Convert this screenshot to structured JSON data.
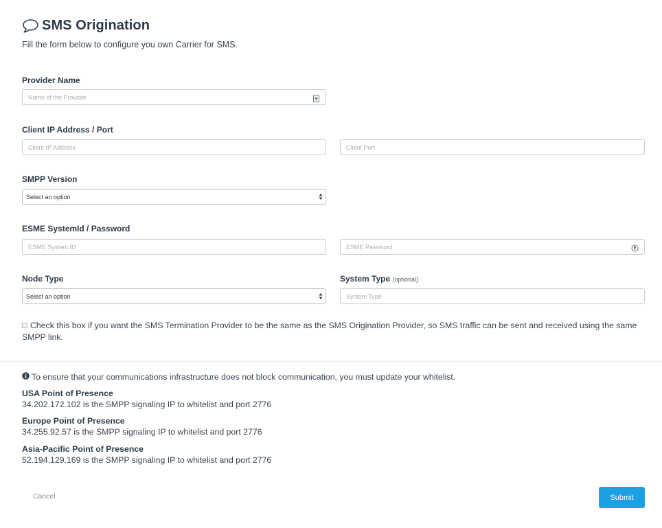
{
  "header": {
    "title": "SMS Origination",
    "subtitle": "Fill the form below to configure you own Carrier for SMS.",
    "icon": "speech-bubble-icon"
  },
  "form": {
    "provider_name": {
      "label": "Provider Name",
      "placeholder": "Name of the Provider",
      "value": ""
    },
    "client_ip": {
      "label": "Client IP Address / Port",
      "ip_placeholder": "Client IP Address",
      "port_placeholder": "Client Port"
    },
    "smpp_version": {
      "label": "SMPP Version",
      "selected": "Select an option"
    },
    "esme": {
      "label": "ESME SystemId / Password",
      "system_id_placeholder": "ESME System ID",
      "password_placeholder": "ESME Password"
    },
    "node_type": {
      "label": "Node Type",
      "selected": "Select an option"
    },
    "system_type": {
      "label": "System Type",
      "optional_note": "(optional)",
      "placeholder": "System Type"
    },
    "same_provider_checkbox": {
      "checked": false,
      "text": "Check this box if you want the SMS Termination Provider to be the same as the SMS Origination Provider, so SMS traffic can be sent and received using the same SMPP link."
    }
  },
  "whitelist": {
    "info_text": "To ensure that your communications infrastructure does not block communication, you must update your whitelist.",
    "points_of_presence": [
      {
        "title": "USA Point of Presence",
        "text": "34.202.172.102 is the SMPP signaling IP to whitelist and port 2776"
      },
      {
        "title": "Europe Point of Presence",
        "text": "34.255.92.57 is the SMPP signaling IP to whitelist and port 2776"
      },
      {
        "title": "Asia-Pacific Point of Presence",
        "text": "52.194.129.169 is the SMPP signaling IP to whitelist and port 2776"
      }
    ]
  },
  "actions": {
    "cancel_label": "Cancel",
    "submit_label": "Submit"
  },
  "colors": {
    "accent": "#1ba1e2",
    "text": "#2e3a45",
    "border": "#c8cdd2"
  }
}
